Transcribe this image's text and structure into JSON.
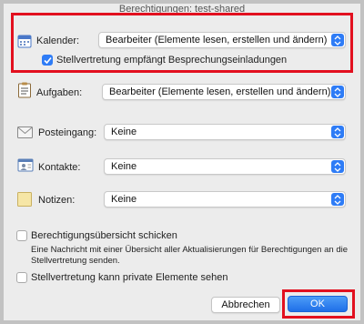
{
  "window": {
    "title": "Berechtigungen: test-shared"
  },
  "calendar": {
    "label": "Kalender:",
    "value": "Bearbeiter (Elemente lesen, erstellen und ändern)",
    "delegate_checkbox_label": "Stellvertretung empfängt Besprechungseinladungen",
    "delegate_checked": true
  },
  "tasks": {
    "label": "Aufgaben:",
    "value": "Bearbeiter (Elemente lesen, erstellen und ändern)"
  },
  "inbox": {
    "label": "Posteingang:",
    "value": "Keine"
  },
  "contacts": {
    "label": "Kontakte:",
    "value": "Keine"
  },
  "notes": {
    "label": "Notizen:",
    "value": "Keine"
  },
  "summary": {
    "label": "Berechtigungsübersicht schicken",
    "checked": false,
    "description": "Eine Nachricht mit einer Übersicht aller Aktualisierungen für Berechtigungen an die Stellvertretung senden."
  },
  "private": {
    "label": "Stellvertretung kann private Elemente sehen",
    "checked": false
  },
  "buttons": {
    "cancel": "Abbrechen",
    "ok": "OK"
  },
  "colors": {
    "accent": "#2e7cf6",
    "highlight": "#e2101f"
  }
}
